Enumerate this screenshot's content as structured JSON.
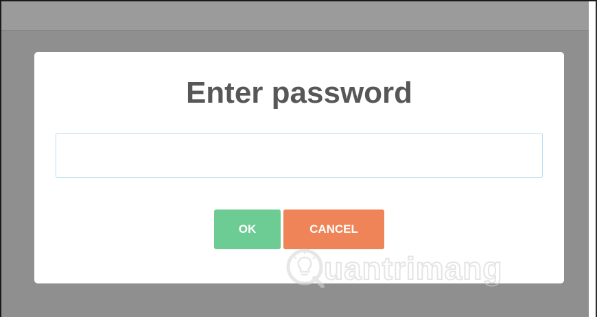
{
  "dialog": {
    "title": "Enter password",
    "password_input": {
      "value": "",
      "placeholder": ""
    },
    "ok_label": "OK",
    "cancel_label": "CANCEL"
  },
  "watermark": {
    "text": "uantrimang",
    "logo_icon": "lightbulb-q-logo-icon"
  },
  "colors": {
    "overlay": "#8f8f8f",
    "ok_button": "#6ccc94",
    "cancel_button": "#ee8457",
    "title_text": "#575757",
    "input_border": "#b9dbf0"
  }
}
